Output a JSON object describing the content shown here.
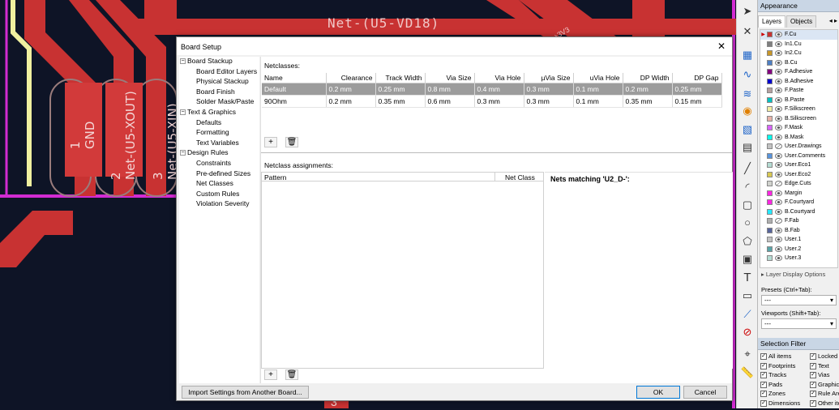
{
  "pcb": {
    "net_label": "Net-(U5-VD18)",
    "net_label_small": "+3V3",
    "pad_labels": [
      {
        "num": "1",
        "name": "GND"
      },
      {
        "num": "2",
        "name": "Net-(U5-XOUT)"
      },
      {
        "num": "3",
        "name": "Net-(U5-XIN)"
      }
    ],
    "bottom_num": "3"
  },
  "colors": {
    "copper": "#c83232",
    "silk": "#f0f0a0",
    "outline": "#d22cd2",
    "bg": "#0e1426",
    "selected_row": "#9c9c9c"
  },
  "toolbar": {
    "icons": [
      "select-arrow-icon",
      "cross-icon",
      "via-grid-icon",
      "route-track-icon",
      "route-diff-icon",
      "via-icon",
      "zone-icon",
      "fill-icon",
      "line-icon",
      "arc-icon",
      "rectangle-icon",
      "circle-icon",
      "polygon-icon",
      "image-icon",
      "text-icon",
      "textbox-icon",
      "dimension-icon",
      "delete-icon",
      "anchor-icon",
      "measure-icon"
    ]
  },
  "appearance": {
    "title": "Appearance",
    "tabs": [
      "Layers",
      "Objects"
    ],
    "tab_arrows": "◂ ▸",
    "layers": [
      {
        "name": "F.Cu",
        "color": "#c83232",
        "selected": true
      },
      {
        "name": "In1.Cu",
        "color": "#7f7f7f"
      },
      {
        "name": "In2.Cu",
        "color": "#c89628"
      },
      {
        "name": "B.Cu",
        "color": "#4d7fc4"
      },
      {
        "name": "F.Adhesive",
        "color": "#84007f"
      },
      {
        "name": "B.Adhesive",
        "color": "#0000cf"
      },
      {
        "name": "F.Paste",
        "color": "#b4a0a0"
      },
      {
        "name": "B.Paste",
        "color": "#00c2c2"
      },
      {
        "name": "F.Silkscreen",
        "color": "#f2eda1"
      },
      {
        "name": "B.Silkscreen",
        "color": "#e8b2a7"
      },
      {
        "name": "F.Mask",
        "color": "#d864ff"
      },
      {
        "name": "B.Mask",
        "color": "#02ffee"
      },
      {
        "name": "User.Drawings",
        "color": "#c2c2c2",
        "hidden": true
      },
      {
        "name": "User.Comments",
        "color": "#5994dc"
      },
      {
        "name": "User.Eco1",
        "color": "#b4dbd2"
      },
      {
        "name": "User.Eco2",
        "color": "#d8c852"
      },
      {
        "name": "Edge.Cuts",
        "color": "#d0d2cd",
        "hidden": true
      },
      {
        "name": "Margin",
        "color": "#ff26e2"
      },
      {
        "name": "F.Courtyard",
        "color": "#ff26e2"
      },
      {
        "name": "B.Courtyard",
        "color": "#26e9ff"
      },
      {
        "name": "F.Fab",
        "color": "#afafaf",
        "hidden": true
      },
      {
        "name": "B.Fab",
        "color": "#58659b"
      },
      {
        "name": "User.1",
        "color": "#c2c2c2"
      },
      {
        "name": "User.2",
        "color": "#59a4a8"
      },
      {
        "name": "User.3",
        "color": "#b4dbd2"
      }
    ],
    "layer_display_options": "Layer Display Options",
    "presets_label": "Presets (Ctrl+Tab):",
    "presets_value": "---",
    "viewports_label": "Viewports (Shift+Tab):",
    "viewports_value": "---",
    "selection_filter_title": "Selection Filter",
    "filters_left": [
      {
        "label": "All items",
        "checked": true
      },
      {
        "label": "Footprints",
        "checked": true
      },
      {
        "label": "Tracks",
        "checked": true
      },
      {
        "label": "Pads",
        "checked": true
      },
      {
        "label": "Zones",
        "checked": true
      },
      {
        "label": "Dimensions",
        "checked": true
      }
    ],
    "filters_right": [
      {
        "label": "Locked",
        "checked": true
      },
      {
        "label": "Text",
        "checked": true
      },
      {
        "label": "Vias",
        "checked": true
      },
      {
        "label": "Graphics",
        "checked": true
      },
      {
        "label": "Rule Areas",
        "checked": true
      },
      {
        "label": "Other items",
        "checked": true
      }
    ]
  },
  "dialog": {
    "title": "Board Setup",
    "close": "✕",
    "tree": [
      {
        "label": "Board Stackup",
        "level": 0
      },
      {
        "label": "Board Editor Layers",
        "level": 1
      },
      {
        "label": "Physical Stackup",
        "level": 1
      },
      {
        "label": "Board Finish",
        "level": 1
      },
      {
        "label": "Solder Mask/Paste",
        "level": 1
      },
      {
        "label": "Text & Graphics",
        "level": 0
      },
      {
        "label": "Defaults",
        "level": 1
      },
      {
        "label": "Formatting",
        "level": 1
      },
      {
        "label": "Text Variables",
        "level": 1
      },
      {
        "label": "Design Rules",
        "level": 0
      },
      {
        "label": "Constraints",
        "level": 1
      },
      {
        "label": "Pre-defined Sizes",
        "level": 1
      },
      {
        "label": "Net Classes",
        "level": 1
      },
      {
        "label": "Custom Rules",
        "level": 1
      },
      {
        "label": "Violation Severity",
        "level": 1
      }
    ],
    "netclasses_label": "Netclasses:",
    "columns": [
      "Name",
      "Clearance",
      "Track Width",
      "Via Size",
      "Via Hole",
      "µVia Size",
      "uVia Hole",
      "DP Width",
      "DP Gap"
    ],
    "rows": [
      [
        "Default",
        "0.2 mm",
        "0.25 mm",
        "0.8 mm",
        "0.4 mm",
        "0.3 mm",
        "0.1 mm",
        "0.2 mm",
        "0.25 mm"
      ],
      [
        "90Ohm",
        "0.2 mm",
        "0.35 mm",
        "0.6 mm",
        "0.3 mm",
        "0.3 mm",
        "0.1 mm",
        "0.35 mm",
        "0.15 mm"
      ]
    ],
    "selected_row": 0,
    "add_icon": "+",
    "delete_icon": "🗑",
    "assignments_label": "Netclass assignments:",
    "assign_columns": [
      "Pattern",
      "Net Class"
    ],
    "nets_matching": "Nets matching 'U2_D-':",
    "import_button": "Import Settings from Another Board...",
    "ok_button": "OK",
    "cancel_button": "Cancel"
  }
}
